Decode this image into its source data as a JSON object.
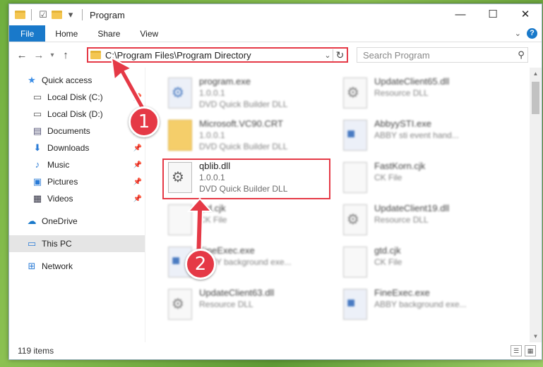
{
  "window": {
    "title": "Program",
    "controls": {
      "minimize": "—",
      "maximize": "☐",
      "close": "✕"
    }
  },
  "ribbon": {
    "tabs": [
      "File",
      "Home",
      "Share",
      "View"
    ]
  },
  "address": {
    "path": "C:\\Program Files\\Program Directory",
    "search_placeholder": "Search Program"
  },
  "sidebar": {
    "items": [
      {
        "label": "Quick access",
        "icon": "star-icon",
        "pinned": false
      },
      {
        "label": "Local Disk (C:)",
        "icon": "drive-icon",
        "pinned": true
      },
      {
        "label": "Local Disk (D:)",
        "icon": "drive-icon",
        "pinned": false
      },
      {
        "label": "Documents",
        "icon": "documents-icon",
        "pinned": true
      },
      {
        "label": "Downloads",
        "icon": "download-icon",
        "pinned": true
      },
      {
        "label": "Music",
        "icon": "music-icon",
        "pinned": true
      },
      {
        "label": "Pictures",
        "icon": "pictures-icon",
        "pinned": true
      },
      {
        "label": "Videos",
        "icon": "videos-icon",
        "pinned": true
      },
      {
        "label": "OneDrive",
        "icon": "cloud-icon",
        "pinned": false
      },
      {
        "label": "This PC",
        "icon": "computer-icon",
        "pinned": false
      },
      {
        "label": "Network",
        "icon": "network-icon",
        "pinned": false
      }
    ]
  },
  "files": [
    {
      "name": "program.exe",
      "line1": "1.0.0.1",
      "line2": "DVD Quick Builder DLL"
    },
    {
      "name": "UpdateClient65.dll",
      "line1": "Resource DLL",
      "line2": ""
    },
    {
      "name": "Microsoft.VC90.CRT",
      "line1": "1.0.0.1",
      "line2": "DVD Quick Builder DLL"
    },
    {
      "name": "AbbyySTI.exe",
      "line1": "ABBY sti event hand...",
      "line2": ""
    },
    {
      "name": "qblib.dll",
      "line1": "1.0.0.1",
      "line2": "DVD Quick Builder DLL"
    },
    {
      "name": "FastKorn.cjk",
      "line1": "CK File",
      "line2": ""
    },
    {
      "name": "gtd.cjk",
      "line1": "CK File",
      "line2": ""
    },
    {
      "name": "UpdateClient19.dll",
      "line1": "Resource DLL",
      "line2": ""
    },
    {
      "name": "FineExec.exe",
      "line1": "ABBY background exe...",
      "line2": ""
    },
    {
      "name": "gtd.cjk",
      "line1": "CK File",
      "line2": ""
    },
    {
      "name": "UpdateClient63.dll",
      "line1": "Resource DLL",
      "line2": ""
    },
    {
      "name": "FineExec.exe",
      "line1": "ABBY background exe...",
      "line2": ""
    }
  ],
  "status": {
    "item_count": "119 items"
  },
  "annotations": {
    "step1": "1",
    "step2": "2"
  },
  "colors": {
    "accent": "#1979ca",
    "annotation": "#e53946"
  }
}
